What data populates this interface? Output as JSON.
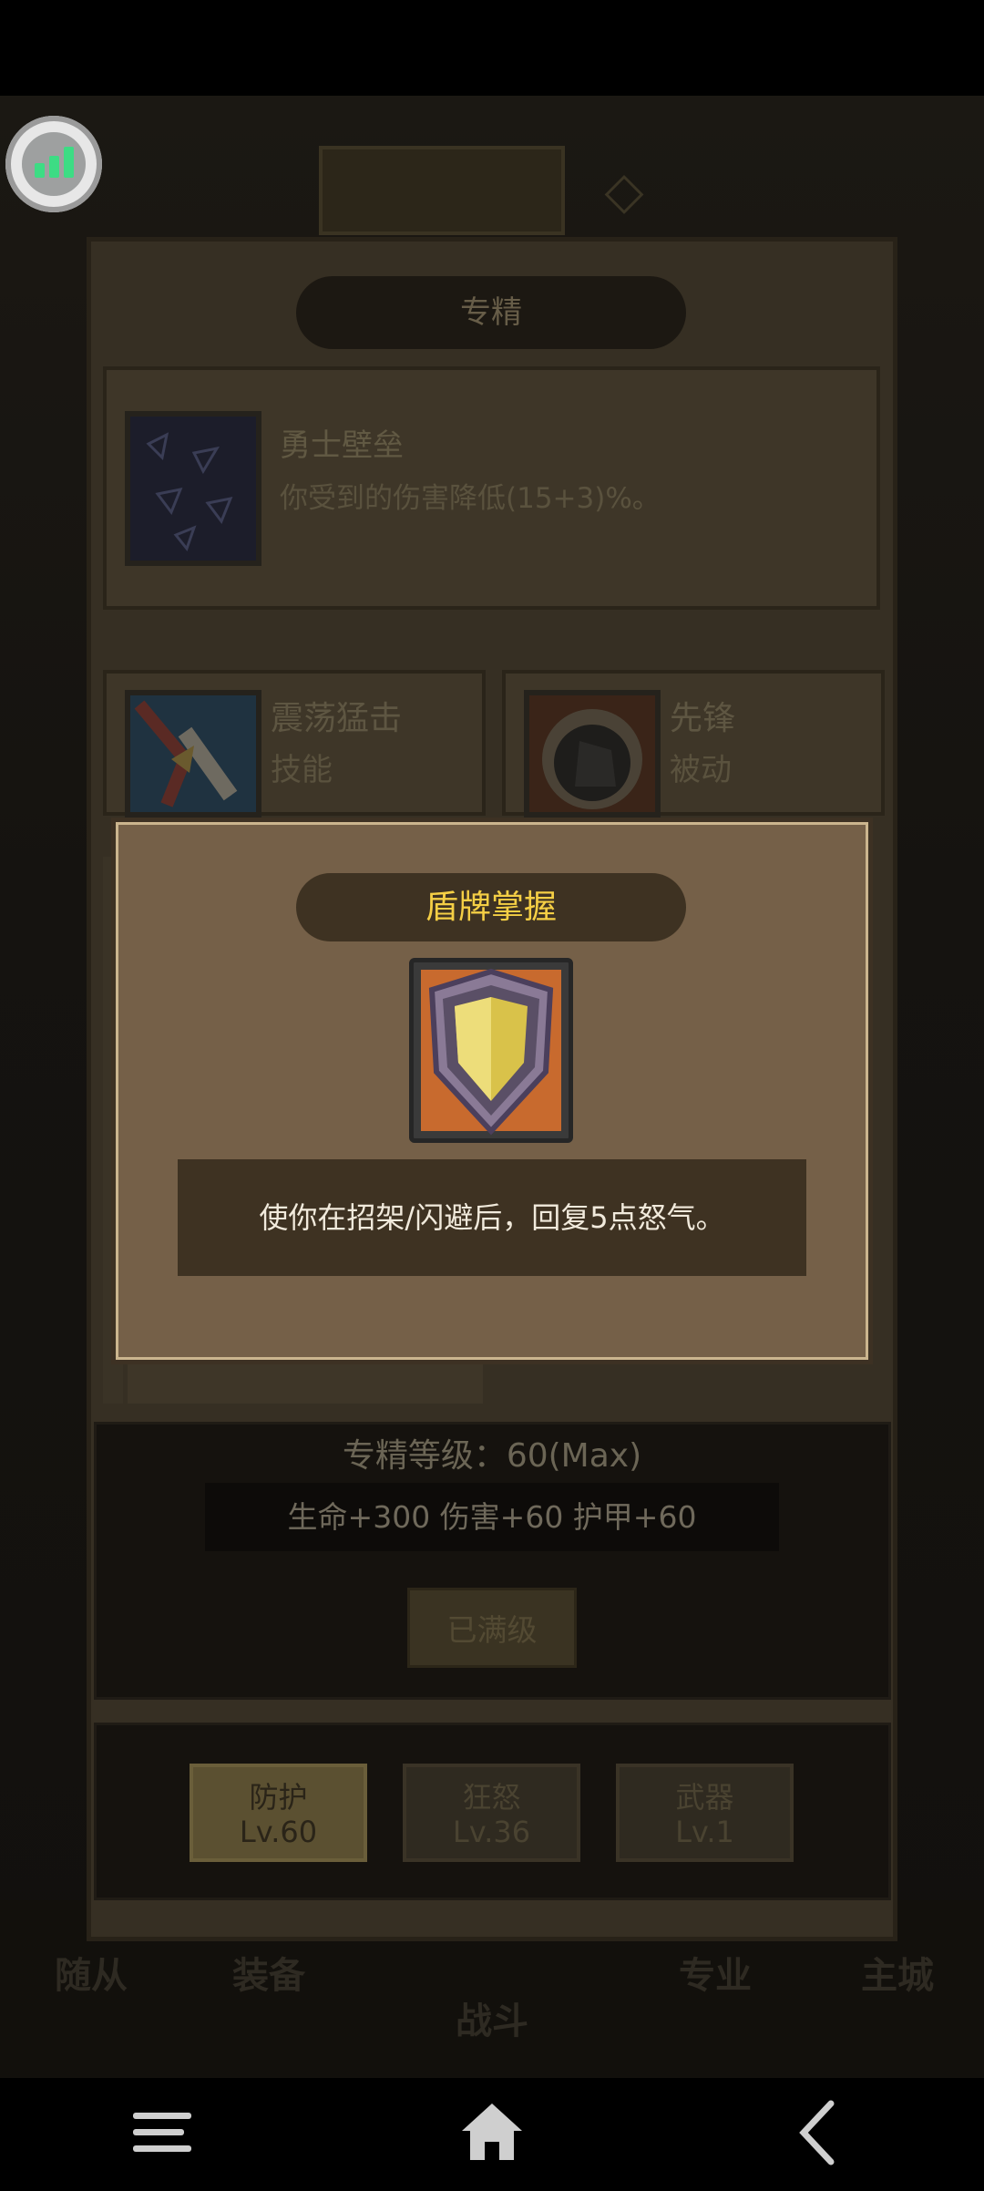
{
  "background": {
    "top_panel_text": "",
    "bottom_tabs": [
      "随从",
      "装备",
      "战斗",
      "专业",
      "主城"
    ]
  },
  "main_panel": {
    "title": "专精",
    "talent_featured": {
      "name": "勇士壁垒",
      "desc": "你受到的伤害降低(15+3)%。"
    },
    "talent_cards": [
      {
        "name": "震荡猛击",
        "type": "技能"
      },
      {
        "name": "先锋",
        "type": "被动"
      }
    ]
  },
  "level": {
    "text": "专精等级：60(Max)",
    "stats": "生命+300  伤害+60  护甲+60",
    "maxed_button": "已满级"
  },
  "spec_tabs": [
    {
      "name": "防护",
      "level": "Lv.60",
      "active": true
    },
    {
      "name": "狂怒",
      "level": "Lv.36",
      "active": false
    },
    {
      "name": "武器",
      "level": "Lv.1",
      "active": false
    }
  ],
  "popup": {
    "title": "盾牌掌握",
    "icon": "shield-icon",
    "desc": "使你在招架/闪避后，回复5点怒气。"
  },
  "colors": {
    "popup_bg": "#756048",
    "popup_title_text": "#f5cf45",
    "widget_bars": "#3ddc84"
  },
  "system_nav": {
    "menu_icon": "menu-icon",
    "home_icon": "home-icon",
    "back_icon": "back-icon"
  }
}
